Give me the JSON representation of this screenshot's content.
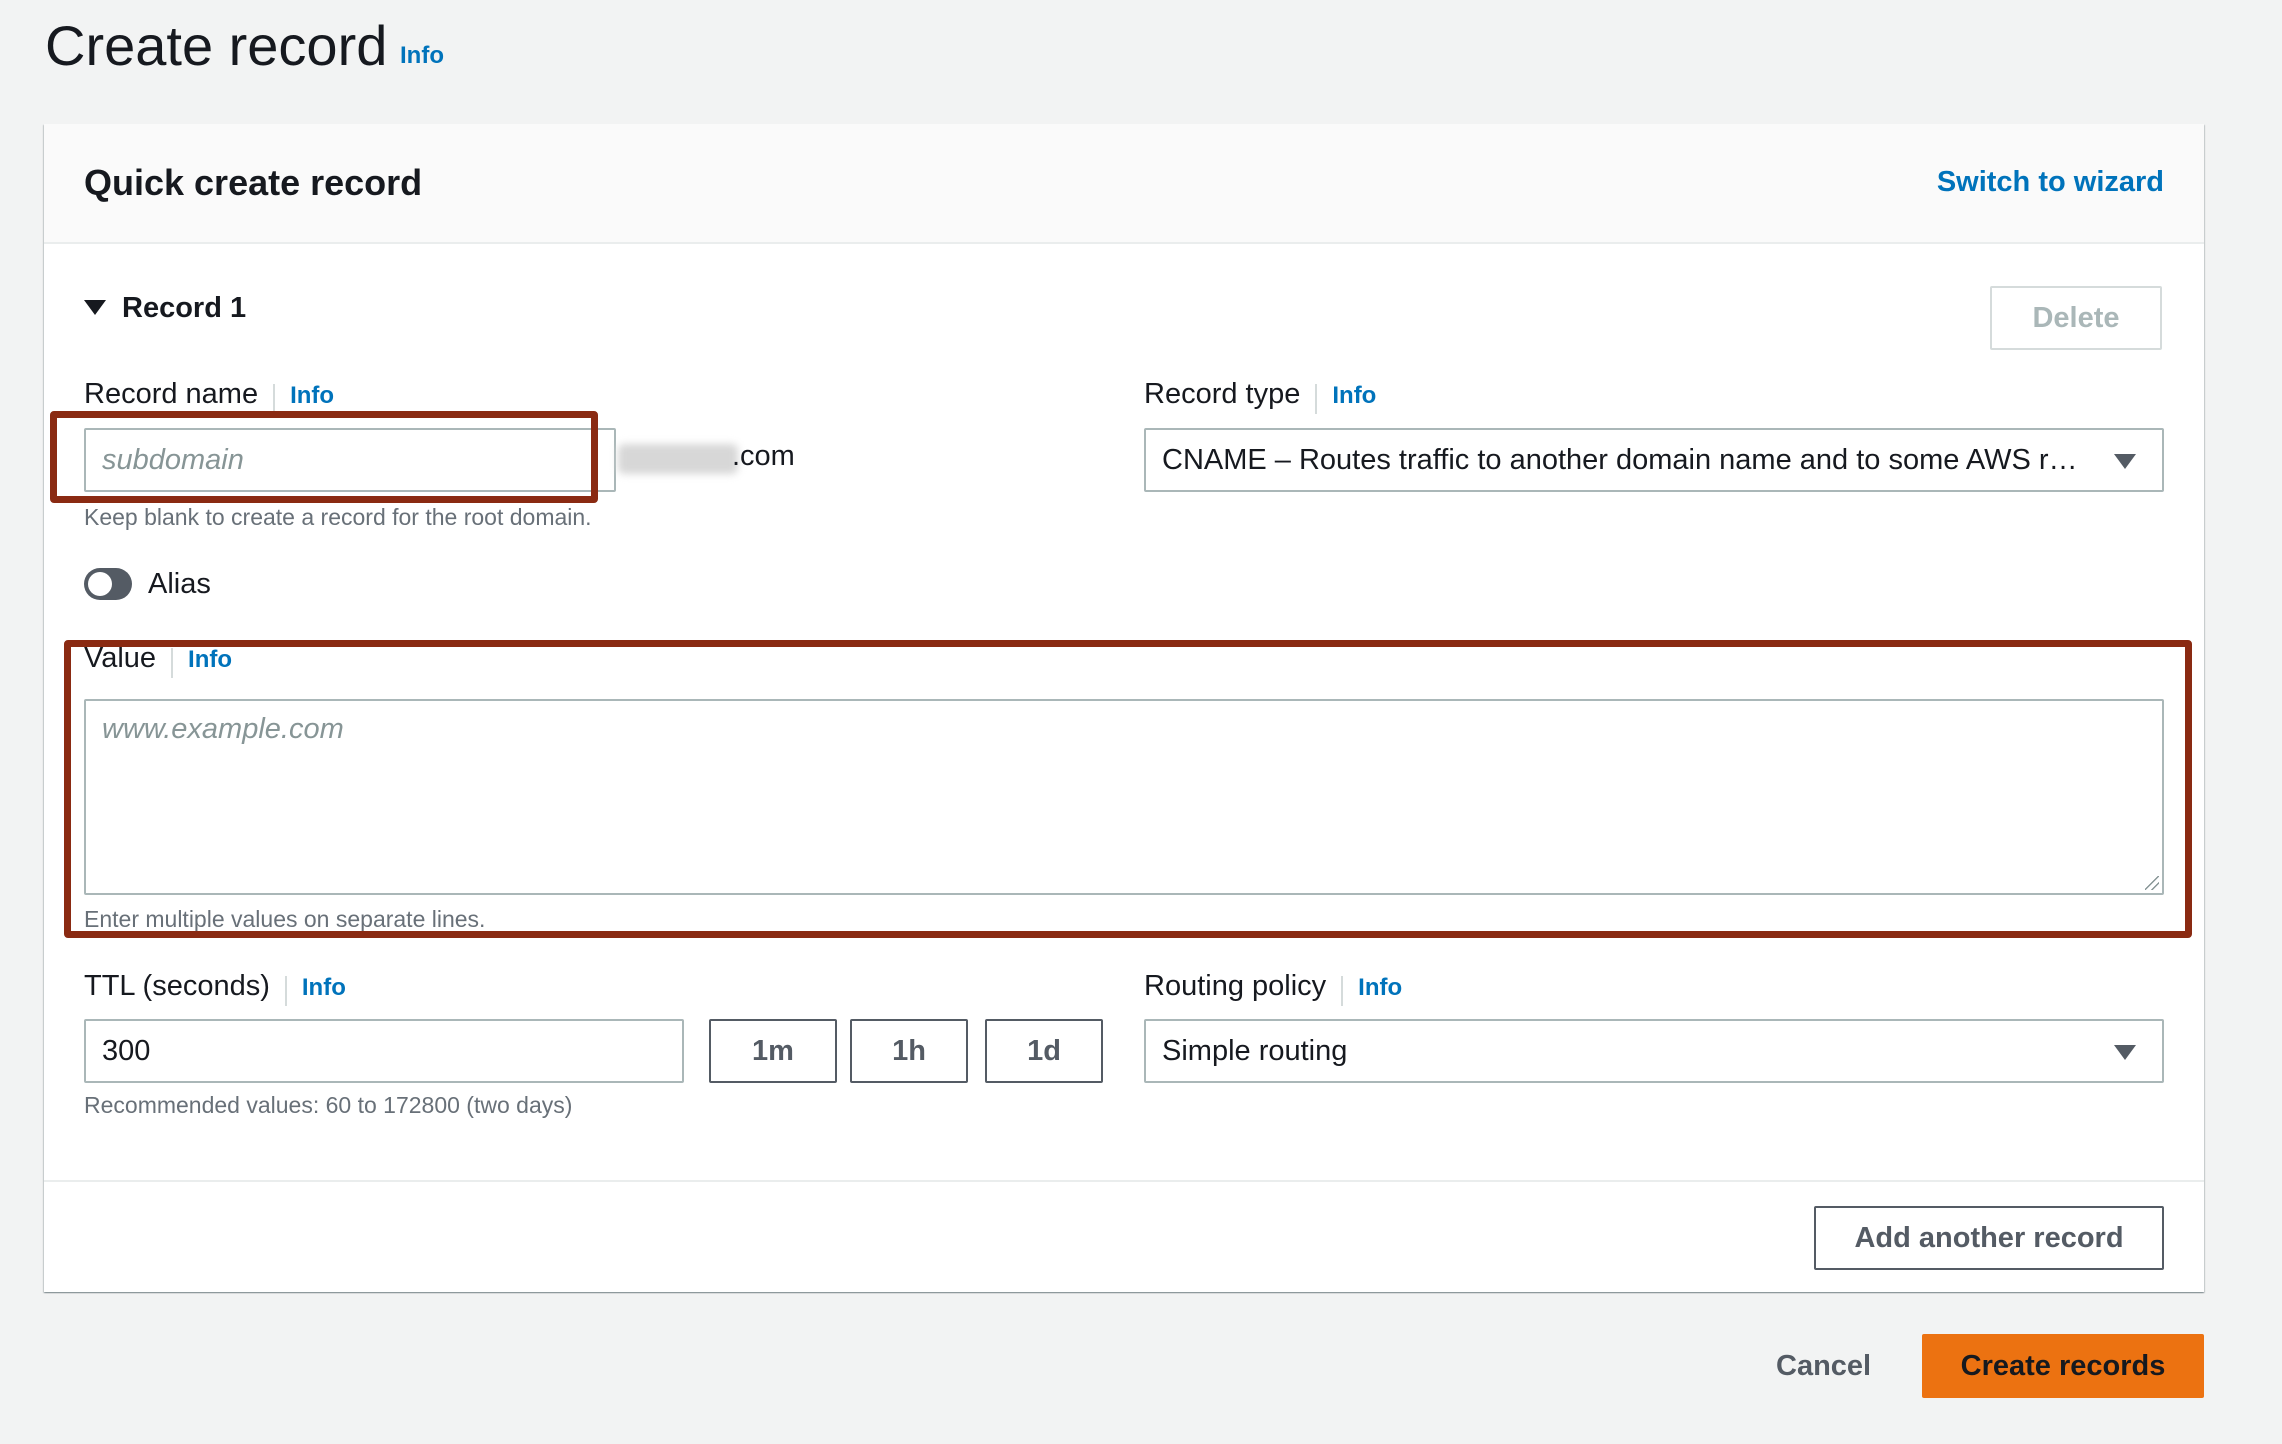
{
  "page": {
    "title": "Create record",
    "info": "Info"
  },
  "card": {
    "title": "Quick create record",
    "switch_link": "Switch to wizard",
    "record": {
      "title": "Record 1",
      "delete_label": "Delete"
    },
    "record_name": {
      "label": "Record name",
      "info": "Info",
      "placeholder": "subdomain",
      "domain_suffix": ".com",
      "hint": "Keep blank to create a record for the root domain."
    },
    "record_type": {
      "label": "Record type",
      "info": "Info",
      "selected": "CNAME – Routes traffic to another domain name and to some AWS reso…"
    },
    "alias": {
      "label": "Alias",
      "enabled": false
    },
    "value": {
      "label": "Value",
      "info": "Info",
      "placeholder": "www.example.com",
      "hint": "Enter multiple values on separate lines."
    },
    "ttl": {
      "label": "TTL (seconds)",
      "info": "Info",
      "value": "300",
      "presets": [
        "1m",
        "1h",
        "1d"
      ],
      "hint": "Recommended values: 60 to 172800 (two days)"
    },
    "routing_policy": {
      "label": "Routing policy",
      "info": "Info",
      "selected": "Simple routing"
    },
    "add_record_label": "Add another record"
  },
  "footer": {
    "cancel_label": "Cancel",
    "create_label": "Create records"
  },
  "colors": {
    "link": "#0073bb",
    "primary": "#ec7211",
    "highlight": "#8a2a12"
  }
}
